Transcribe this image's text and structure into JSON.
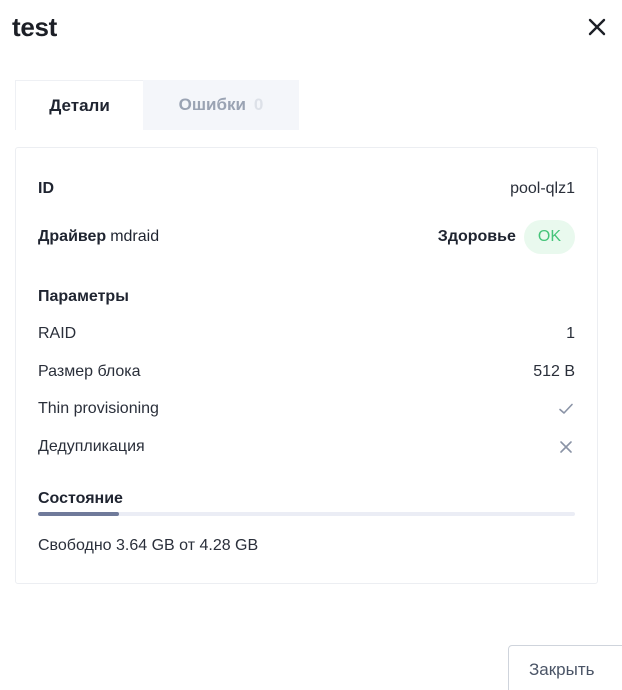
{
  "dialog": {
    "title": "test",
    "close_icon": "close-icon"
  },
  "tabs": [
    {
      "label": "Детали",
      "active": true
    },
    {
      "label": "Ошибки",
      "count": "0",
      "active": false
    }
  ],
  "details": {
    "id_label": "ID",
    "id_value": "pool-qlz1",
    "driver_label": "Драйвер",
    "driver_value": "mdraid",
    "health_label": "Здоровье",
    "health_value": "OK",
    "health_color": "#46c47a"
  },
  "params": {
    "heading": "Параметры",
    "raid_label": "RAID",
    "raid_value": "1",
    "block_label": "Размер блока",
    "block_value": "512 B",
    "thin_label": "Thin provisioning",
    "thin_value_icon": "check-icon",
    "dedup_label": "Дедупликация",
    "dedup_value_icon": "cross-icon"
  },
  "state": {
    "heading": "Состояние",
    "used_fraction": 0.15,
    "free_text": "Свободно 3.64 GB от 4.28 GB"
  },
  "footer": {
    "close_label": "Закрыть"
  },
  "colors": {
    "accent_progress": "#6f7a9a",
    "muted_icon": "#8a93a6"
  }
}
